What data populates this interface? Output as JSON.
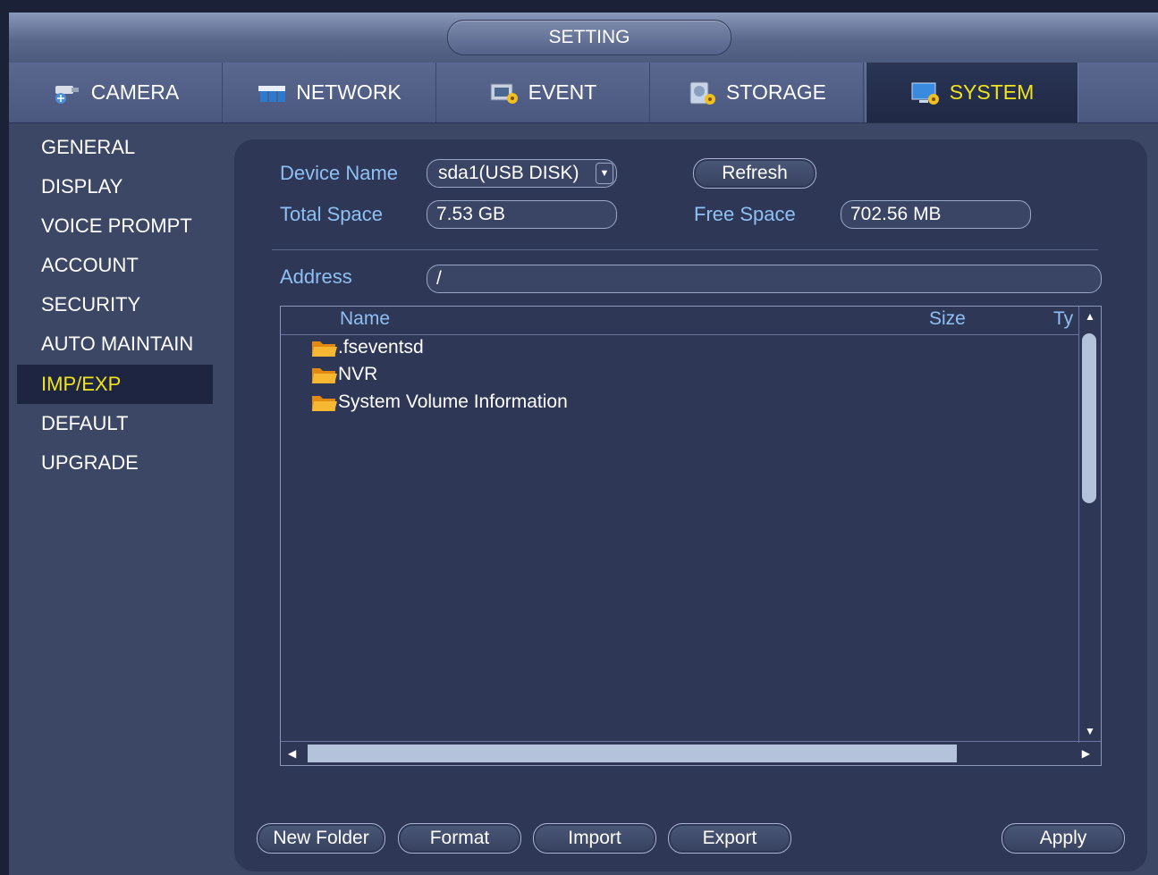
{
  "window": {
    "title": "SETTING"
  },
  "tabs": [
    {
      "label": "CAMERA",
      "icon": "camera-icon"
    },
    {
      "label": "NETWORK",
      "icon": "network-icon"
    },
    {
      "label": "EVENT",
      "icon": "event-icon"
    },
    {
      "label": "STORAGE",
      "icon": "storage-icon"
    },
    {
      "label": "SYSTEM",
      "icon": "system-icon",
      "active": true
    }
  ],
  "sidebar": {
    "items": [
      {
        "label": "GENERAL"
      },
      {
        "label": "DISPLAY"
      },
      {
        "label": "VOICE PROMPT"
      },
      {
        "label": "ACCOUNT"
      },
      {
        "label": "SECURITY"
      },
      {
        "label": "AUTO MAINTAIN"
      },
      {
        "label": "IMP/EXP",
        "active": true
      },
      {
        "label": "DEFAULT"
      },
      {
        "label": "UPGRADE"
      }
    ]
  },
  "form": {
    "device_name_label": "Device Name",
    "device_name_value": "sda1(USB DISK)",
    "refresh_label": "Refresh",
    "total_space_label": "Total Space",
    "total_space_value": "7.53 GB",
    "free_space_label": "Free Space",
    "free_space_value": "702.56 MB",
    "address_label": "Address",
    "address_value": "/"
  },
  "filelist": {
    "columns": [
      "Name",
      "Size",
      "Ty"
    ],
    "rows": [
      {
        "name": ".fseventsd"
      },
      {
        "name": "NVR"
      },
      {
        "name": "System Volume Information"
      }
    ]
  },
  "buttons": {
    "new_folder": "New Folder",
    "format": "Format",
    "import": "Import",
    "export": "Export",
    "apply": "Apply"
  },
  "colors": {
    "accent_yellow": "#f1e31c",
    "label_blue": "#8fc0f3",
    "panel_bg": "#2e3756"
  }
}
